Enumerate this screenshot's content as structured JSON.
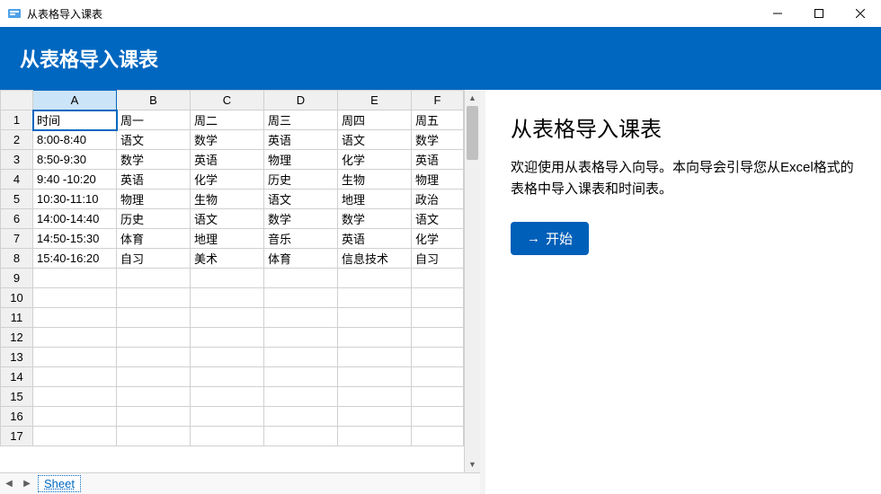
{
  "window": {
    "title": "从表格导入课表"
  },
  "header": {
    "title": "从表格导入课表"
  },
  "wizard": {
    "title": "从表格导入课表",
    "description": "欢迎使用从表格导入向导。本向导会引导您从Excel格式的表格中导入课表和时间表。",
    "start_label": "开始"
  },
  "sheet": {
    "tab_name": "Sheet",
    "columns": [
      "A",
      "B",
      "C",
      "D",
      "E",
      "F"
    ],
    "active_cell": "A1",
    "rows": [
      [
        "时间",
        "周一",
        "周二",
        "周三",
        "周四",
        "周五"
      ],
      [
        "8:00-8:40",
        "语文",
        "数学",
        "英语",
        "语文",
        "数学"
      ],
      [
        "8:50-9:30",
        "数学",
        "英语",
        "物理",
        "化学",
        "英语"
      ],
      [
        "9:40 -10:20",
        "英语",
        "化学",
        "历史",
        "生物",
        "物理"
      ],
      [
        "10:30-11:10",
        "物理",
        "生物",
        "语文",
        "地理",
        "政治"
      ],
      [
        "14:00-14:40",
        "历史",
        "语文",
        "数学",
        "数学",
        "语文"
      ],
      [
        "14:50-15:30",
        "体育",
        "地理",
        "音乐",
        "英语",
        "化学"
      ],
      [
        "15:40-16:20",
        "自习",
        "美术",
        "体育",
        "信息技术",
        "自习"
      ],
      [
        "",
        "",
        "",
        "",
        "",
        ""
      ],
      [
        "",
        "",
        "",
        "",
        "",
        ""
      ],
      [
        "",
        "",
        "",
        "",
        "",
        ""
      ],
      [
        "",
        "",
        "",
        "",
        "",
        ""
      ],
      [
        "",
        "",
        "",
        "",
        "",
        ""
      ],
      [
        "",
        "",
        "",
        "",
        "",
        ""
      ],
      [
        "",
        "",
        "",
        "",
        "",
        ""
      ],
      [
        "",
        "",
        "",
        "",
        "",
        ""
      ],
      [
        "",
        "",
        "",
        "",
        "",
        ""
      ]
    ]
  }
}
